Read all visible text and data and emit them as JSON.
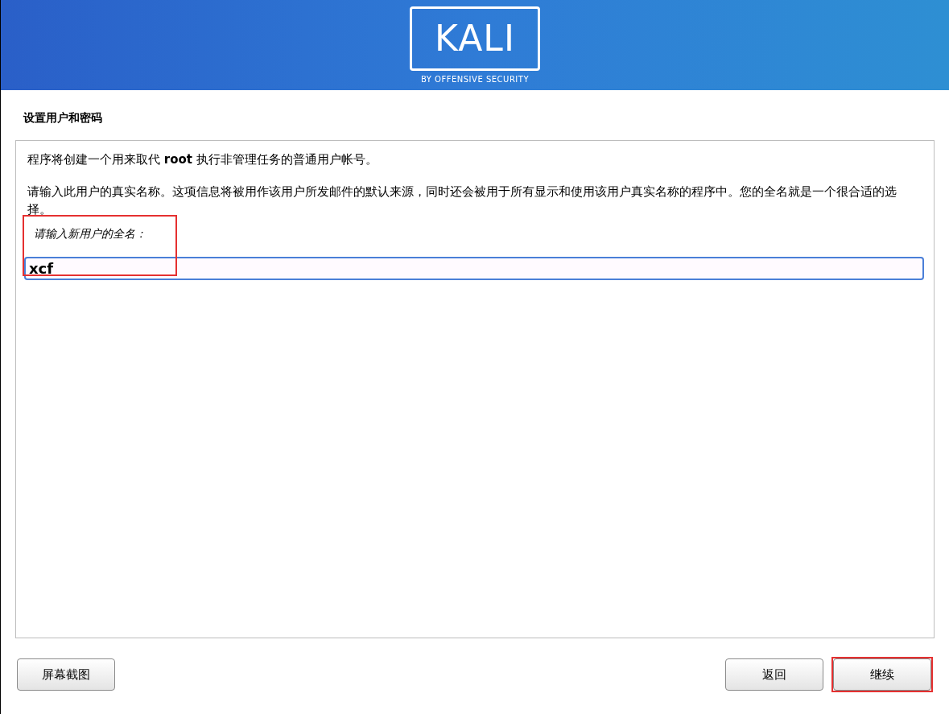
{
  "header": {
    "logo": "KALI",
    "tagline": "BY OFFENSIVE SECURITY"
  },
  "step_title": "设置用户和密码",
  "paragraphs": [
    "程序将创建一个用来取代 **root** 执行非管理任务的普通用户帐号。",
    "请输入此用户的真实名称。这项信息将被用作该用户所发邮件的默认来源，同时还会被用于所有显示和使用该用户真实名称的程序中。您的全名就是一个很合适的选择。"
  ],
  "field": {
    "label": "请输入新用户的全名：",
    "value": "xcf",
    "highlighted": true
  },
  "buttons": [
    {
      "label": "屏幕截图",
      "kind": "left",
      "highlighted": false
    },
    {
      "label": "返回",
      "kind": "right",
      "highlighted": false
    },
    {
      "label": "继续",
      "kind": "right",
      "highlighted": true
    }
  ]
}
